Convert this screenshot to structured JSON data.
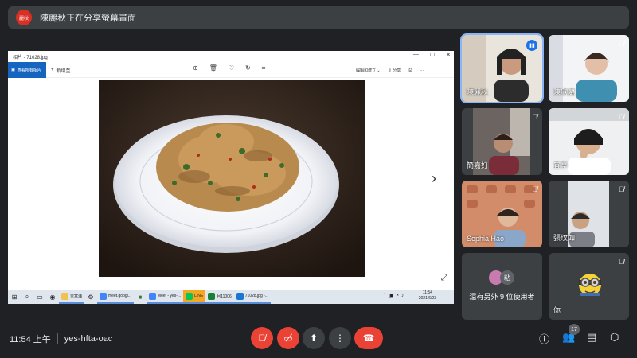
{
  "presenter": {
    "avatar_text": "麗秋",
    "banner": "陳麗秋正在分享螢幕畫面"
  },
  "photo_app": {
    "title": "相片 - 71028.jpg",
    "see_all": "查看所有相片",
    "add_to": "新增至",
    "edit_create": "編輯和建立",
    "share": "分享"
  },
  "taskbar": {
    "apps": [
      "吉富浦",
      "meet.googl...",
      "Meet - yes-...",
      "LINE",
      "月11006",
      "71028.jpg -..."
    ],
    "time": "11:54",
    "date": "2021/6/23"
  },
  "participants": [
    {
      "name": "陳麗秋",
      "state": "speaking"
    },
    {
      "name": "陳欣葳",
      "state": "muted"
    },
    {
      "name": "簡嘉好",
      "state": "muted"
    },
    {
      "name": "宜亭",
      "state": "muted"
    },
    {
      "name": "Sophia Hao",
      "state": "muted"
    },
    {
      "name": "張玟如",
      "state": "muted"
    }
  ],
  "others_tile": {
    "avatar_text": "粘",
    "label": "還有另外 9 位使用者"
  },
  "you_tile": {
    "label": "你"
  },
  "meeting": {
    "time": "11:54 上午",
    "code": "yes-hfta-oac",
    "participant_count": "17"
  },
  "colors": {
    "accent": "#8ab4f8",
    "danger": "#ea4335",
    "bg": "#202124",
    "tile": "#3c4043"
  }
}
